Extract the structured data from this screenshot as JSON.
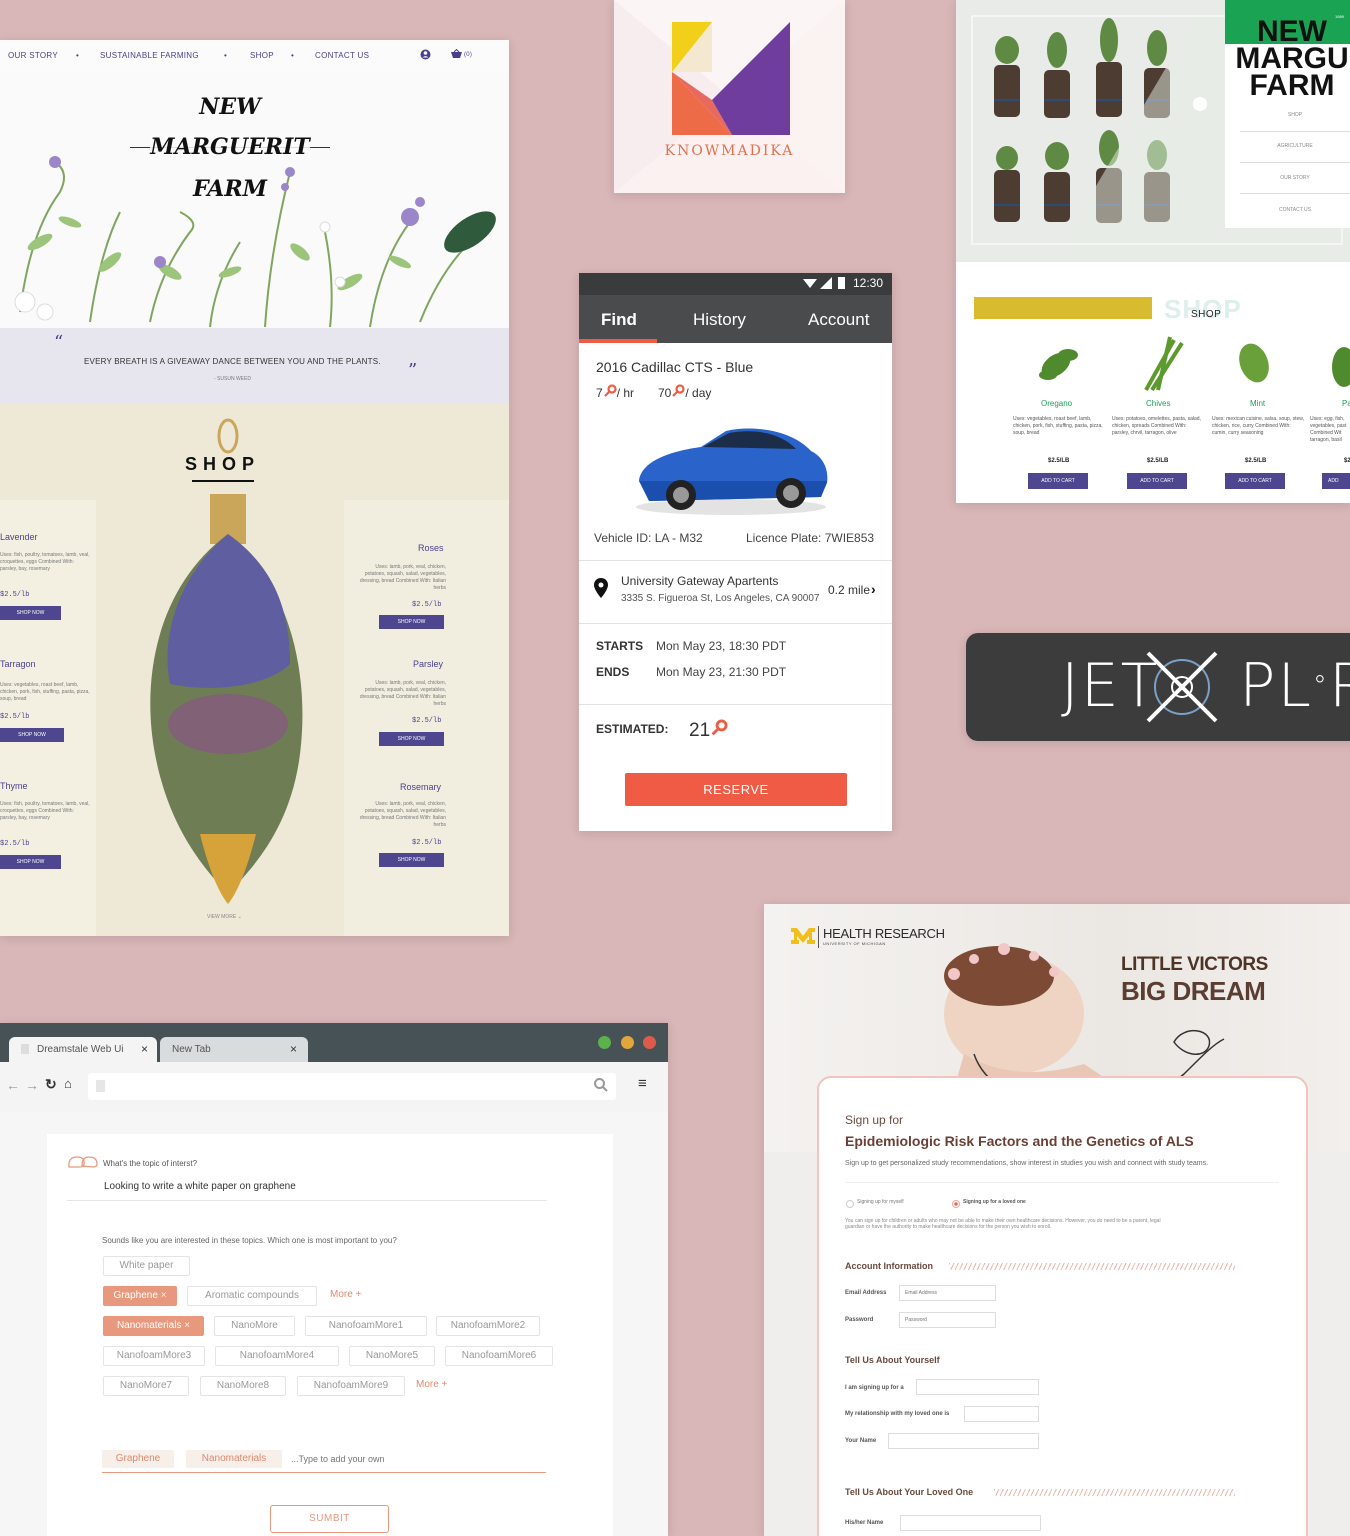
{
  "colors": {
    "background": "#d9b6b7",
    "farm_purple": "#4e468f",
    "car_accent": "#ef5b45",
    "car_dark": "#4a4b4c",
    "jet_bg": "#3d3c3c",
    "browser_accent": "#e8987c",
    "health_brown": "#5b3d31",
    "green_farm": "#1aa353"
  },
  "farm": {
    "nav": {
      "our_story": "OUR STORY",
      "sustainable": "SUSTAINABLE FARMING",
      "shop": "SHOP",
      "contact": "CONTACT US",
      "cart_count": "(0)",
      "sep": "•"
    },
    "title_line1": "NEW",
    "title_line2": "MARGUERIT",
    "title_line3": "FARM",
    "quote": "EVERY BREATH IS A GIVEAWAY DANCE BETWEEN YOU AND THE PLANTS.",
    "quote_author": "- SUSUN WEED",
    "quote_open": "“",
    "quote_close": "”",
    "shop_title": "SHOP",
    "view_more": "VIEW MORE",
    "products_left": [
      {
        "name": "Lavender",
        "desc": "Uses: fish, poultry, tomatoes, lamb, veal, croquettes, eggs Combined With: parsley, bay, rosemary",
        "price": "$2.5/lb",
        "btn": "SHOP NOW"
      },
      {
        "name": "Tarragon",
        "desc": "Uses: vegetables, roast beef, lamb, chicken, pork, fish, stuffing, pasta, pizza, soup, bread",
        "price": "$2.5/lb",
        "btn": "SHOP NOW"
      },
      {
        "name": "Thyme",
        "desc": "Uses: fish, poultry, tomatoes, lamb, veal, croquettes, eggs Combined With: parsley, bay, rosemary",
        "price": "$2.5/lb",
        "btn": "SHOP NOW"
      }
    ],
    "products_right": [
      {
        "name": "Roses",
        "desc": "Uses: lamb, pork, veal, chicken, potatoes, squash, salad, vegetables, dressing, bread Combined With: Italian herbs",
        "price": "$2.5/lb",
        "btn": "SHOP NOW"
      },
      {
        "name": "Parsley",
        "desc": "Uses: lamb, pork, veal, chicken, potatoes, squash, salad, vegetables, dressing, bread Combined With: Italian herbs",
        "price": "$2.5/lb",
        "btn": "SHOP NOW"
      },
      {
        "name": "Rosemary",
        "desc": "Uses: lamb, pork, veal, chicken, potatoes, squash, salad, vegetables, dressing, bread Combined With: Italian herbs",
        "price": "$2.5/lb",
        "btn": "SHOP NOW"
      }
    ]
  },
  "knowmadika": {
    "brand": "KNOWMADIKA"
  },
  "green_farm": {
    "title_line1": "NEW",
    "title_line2": "MARGU",
    "title_line3": "FARM",
    "year": "1989",
    "menu": [
      "SHOP",
      "AGRICULTURE",
      "OUR STORY",
      "CONTACT US"
    ],
    "shop_title": "SHOP",
    "products": [
      {
        "name": "Oregano",
        "desc": "Uses: vegetables, roast beef, lamb, chicken, pork, fish, stuffing, pasta, pizza, soup, bread",
        "price": "$2.5/LB",
        "btn": "ADD TO CART"
      },
      {
        "name": "Chives",
        "desc": "Uses: potatoes, omelettes, pasta, salad, chicken, spreads Combined With: parsley, chrvil, tarragon, olive",
        "price": "$2.5/LB",
        "btn": "ADD TO CART"
      },
      {
        "name": "Mint",
        "desc": "Uses: mexican cuisine, salsa, soup, stew, chicken, rice, curry Combined With: cumin, curry seasoning",
        "price": "$2.5/LB",
        "btn": "ADD TO CART"
      },
      {
        "name": "Pa",
        "desc": "Uses: egg, fish, vegetables, past Combined Wit tarragon, basil",
        "price": "$2",
        "btn": "ADD"
      }
    ]
  },
  "car_app": {
    "time": "12:30",
    "tabs": [
      "Find",
      "History",
      "Account"
    ],
    "vehicle": "2016 Cadillac CTS - Blue",
    "rate_hr_value": "7",
    "rate_hr_unit": "/ hr",
    "rate_day_value": "70",
    "rate_day_unit": "/ day",
    "vehicle_id": "Vehicle ID: LA - M32",
    "plate": "Licence Plate: 7WIE853",
    "location_name": "University Gateway Apartents",
    "location_address": "3335 S. Figueroa St, Los Angeles, CA 90007",
    "distance": "0.2 mile",
    "starts_label": "STARTS",
    "starts_value": "Mon May 23, 18:30 PDT",
    "ends_label": "ENDS",
    "ends_value": "Mon May 23, 21:30 PDT",
    "estimated_label": "ESTIMATED:",
    "estimated_value": "21",
    "reserve": "RESERVE"
  },
  "jetxplore": {
    "part1": "JET",
    "part2": "PL",
    "part3": "RE"
  },
  "browser": {
    "tab1": "Dreamstale Web Ui",
    "tab2": "New Tab",
    "question": "What's the topic of interst?",
    "answer": "Looking to write a white paper on graphene",
    "prompt": "Sounds like you are interested in these topics. Which one is most important to you?",
    "chip_row1": [
      "White paper"
    ],
    "chip_row2": [
      "Graphene ×",
      "Aromatic compounds",
      "More +"
    ],
    "chip_row3": [
      "Nanomaterials ×",
      "NanoMore",
      "NanofoamMore1",
      "NanofoamMore2"
    ],
    "chip_row4": [
      "NanofoamMore3",
      "NanofoamMore4",
      "NanoMore5",
      "NanofoamMore6"
    ],
    "chip_row5": [
      "NanoMore7",
      "NanoMore8",
      "NanofoamMore9",
      "More +"
    ],
    "selected": [
      "Graphene",
      "Nanomaterials"
    ],
    "add_placeholder": "...Type to add your own",
    "submit": "SUMBIT"
  },
  "health": {
    "logo": "HEALTH RESEARCH",
    "logo_sub": "UNIVERSITY OF MICHIGAN",
    "headline1": "LITTLE VICTORS",
    "headline2": "BIG DREAM",
    "signup": "Sign up for",
    "study": "Epidemiologic Risk Factors and the Genetics of ALS",
    "intro": "Sign up to get personalized study recommendations, show interest in studies you wish and connect with study teams.",
    "opt_self": "Signing up for myself",
    "opt_loved": "Signing up for a loved one",
    "note": "You can sign up for children or adults who may not be able to make their own healthcare decisions. However, you do need to be a parent, legal guardian or have the authority to make healthcare decisions for the person you wish to enroll.",
    "account_heading": "Account Information",
    "email_label": "Email Address",
    "email_ph": "Email Address",
    "password_label": "Password",
    "password_ph": "Password",
    "about_heading": "Tell Us About Yourself",
    "signing_for": "I am signing up for a",
    "relationship": "My relationship with my loved one is",
    "your_name": "Your Name",
    "loved_heading": "Tell Us About Your Loved One",
    "his_her_name": "His/her Name"
  }
}
